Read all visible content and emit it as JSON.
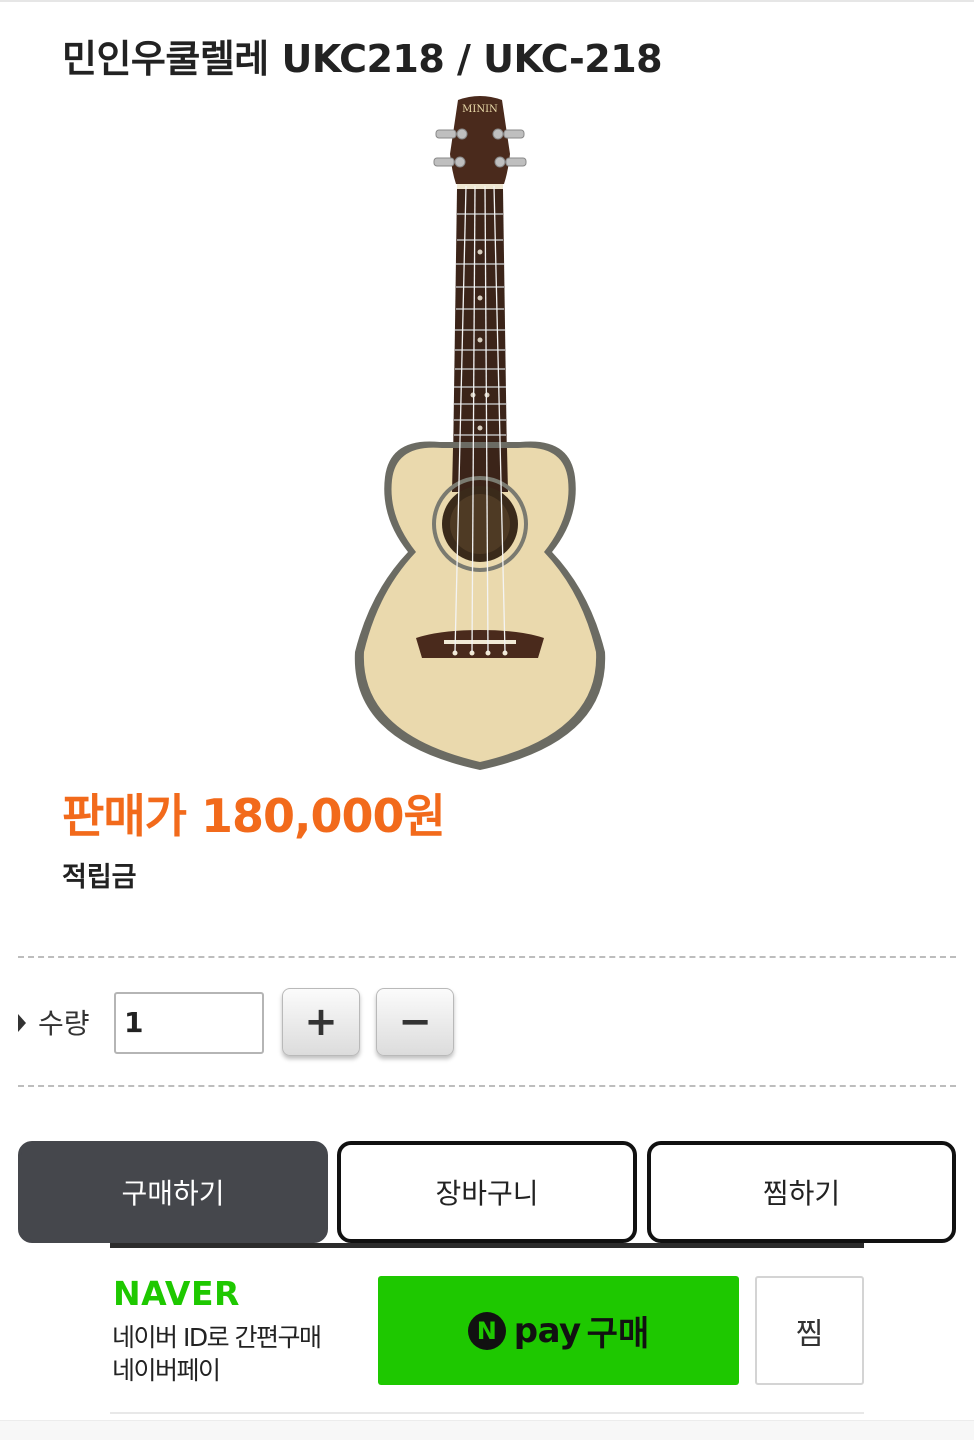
{
  "product": {
    "title": "민인우쿨렐레 UKC218 / UKC-218",
    "image_brand_text": "MININ",
    "price": "판매가 180,000원",
    "points_label": "적립금"
  },
  "quantity": {
    "label": "수량",
    "value": "1",
    "plus": "+",
    "minus": "−"
  },
  "actions": {
    "buy": "구매하기",
    "cart": "장바구니",
    "wishlist": "찜하기"
  },
  "naver_pay": {
    "logo": "NAVER",
    "desc_line1": "네이버 ID로 간편구매",
    "desc_line2": "네이버페이",
    "n_mark": "N",
    "pay_text": "pay",
    "buy_text": "구매",
    "zzim": "찜"
  },
  "colors": {
    "price": "#f26a1b",
    "buy_button": "#45474c",
    "naver_green": "#1ec800"
  }
}
